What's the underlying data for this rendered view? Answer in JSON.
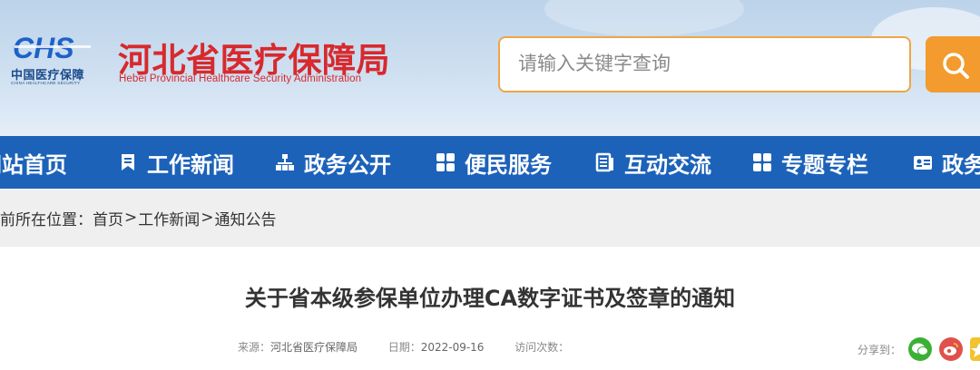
{
  "header": {
    "logo_text_cn": "中国医疗保障",
    "logo_text_en": "CHINA HEALTHCARE SECURITY",
    "logo_mark": "CHS",
    "title": "河北省医疗保障局",
    "subtitle": "Hebei Provincial Healthcare Security Administration",
    "search_placeholder": "请输入关键字查询",
    "search_icon": "search-icon",
    "colors": {
      "brand_red": "#d8292d",
      "search_accent": "#f39b2e",
      "nav_blue": "#1c62b9"
    }
  },
  "nav": {
    "items": [
      {
        "label": "网站首页",
        "icon": ""
      },
      {
        "label": "工作新闻",
        "icon": "bookmark-icon"
      },
      {
        "label": "政务公开",
        "icon": "org-chart-icon"
      },
      {
        "label": "便民服务",
        "icon": "grid-icon"
      },
      {
        "label": "互动交流",
        "icon": "document-icon"
      },
      {
        "label": "专题专栏",
        "icon": "grid-icon"
      },
      {
        "label": "政务",
        "icon": "id-card-icon"
      }
    ]
  },
  "breadcrumb": {
    "prefix": "前所在位置：",
    "items": [
      "首页",
      "工作新闻",
      "通知公告"
    ],
    "separator": ">"
  },
  "article": {
    "title": "关于省本级参保单位办理CA数字证书及签章的通知",
    "source_label": "来源：",
    "source_value": "河北省医疗保障局",
    "date_label": "日期：",
    "date_value": "2022-09-16",
    "visits_label": "访问次数：",
    "share_label": "分享到："
  }
}
